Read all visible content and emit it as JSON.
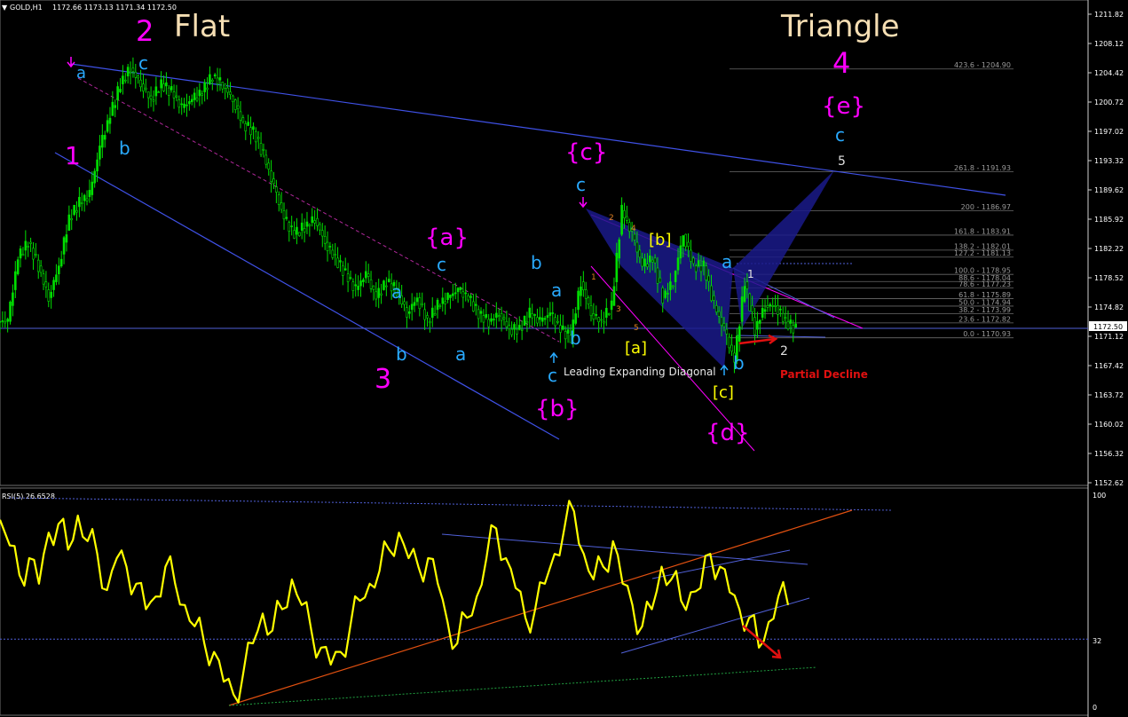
{
  "header": {
    "symbol": "GOLD,H1",
    "ohlc": "1172.66 1173.13 1171.34 1172.50",
    "rsi_label": "RSI(5) 26.6528"
  },
  "titles": {
    "flat_num": "2",
    "flat": "Flat",
    "triangle": "Triangle",
    "triangle_num": "4"
  },
  "texts": {
    "leading_diagonal": "Leading Expanding Diagonal",
    "partial_decline": "Partial Decline"
  },
  "colors": {
    "background": "#000000",
    "bull_candle": "#00e000",
    "wave_magenta": "#ff00ff",
    "wave_cyan": "#29aaff",
    "wave_yellow": "#ffff00",
    "title_beige": "#f5deb3",
    "rsi_line": "#ffff00",
    "trendline_blue": "#3f51e6",
    "annotation_red": "#e01010",
    "triangle_fill": "#1a1a8a"
  },
  "chart_data": [
    {
      "type": "candlestick",
      "title": "",
      "ylim": [
        1152.62,
        1213.0
      ],
      "y_ticks": [
        "1211.82",
        "1208.12",
        "1204.42",
        "1200.72",
        "1197.02",
        "1193.32",
        "1189.62",
        "1185.92",
        "1182.22",
        "1178.52",
        "1174.82",
        "1171.12",
        "1167.42",
        "1163.72",
        "1160.02",
        "1156.32",
        "1152.62"
      ],
      "current_price": "1172.50",
      "close_path": [
        1173,
        1181,
        1183,
        1180,
        1176,
        1180,
        1186,
        1188,
        1189,
        1195,
        1199,
        1203,
        1205,
        1203,
        1201,
        1203,
        1202,
        1200,
        1201,
        1202,
        1204,
        1203,
        1201,
        1198,
        1197,
        1194,
        1190,
        1186,
        1184,
        1185,
        1186,
        1183,
        1181,
        1179,
        1177,
        1179,
        1176,
        1178,
        1177,
        1174,
        1176,
        1173,
        1175,
        1176,
        1177,
        1176,
        1174,
        1173,
        1174,
        1172,
        1172,
        1174,
        1173,
        1174,
        1172,
        1171,
        1178,
        1174,
        1173,
        1175,
        1187,
        1184,
        1180,
        1181,
        1176,
        1178,
        1184,
        1180,
        1180,
        1175,
        1172,
        1168,
        1178,
        1172,
        1175,
        1175,
        1173,
        1172
      ],
      "fib_levels": [
        {
          "label": "423.6 - 1204.90",
          "value": 1204.9
        },
        {
          "label": "261.8 - 1191.93",
          "value": 1191.93
        },
        {
          "label": "200 - 1186.97",
          "value": 1186.97
        },
        {
          "label": "161.8 - 1183.91",
          "value": 1183.91
        },
        {
          "label": "138.2 - 1182.01",
          "value": 1182.01
        },
        {
          "label": "127.2 - 1181.13",
          "value": 1181.13
        },
        {
          "label": "100.0 - 1178.95",
          "value": 1178.95
        },
        {
          "label": "88.6 - 1178.04",
          "value": 1178.04
        },
        {
          "label": "78.6 - 1177.23",
          "value": 1177.23
        },
        {
          "label": "61.8 - 1175.89",
          "value": 1175.89
        },
        {
          "label": "50.0 - 1174.94",
          "value": 1174.94
        },
        {
          "label": "38.2 - 1173.99",
          "value": 1173.99
        },
        {
          "label": "23.6 - 1172.82",
          "value": 1172.82
        },
        {
          "label": "0.0 - 1170.93",
          "value": 1170.93
        }
      ],
      "wave_labels": [
        {
          "text": "2",
          "role": "magenta"
        },
        {
          "text": "1",
          "role": "magenta"
        },
        {
          "text": "3",
          "role": "magenta"
        },
        {
          "text": "4",
          "role": "magenta"
        },
        {
          "text": "{a}",
          "role": "magenta"
        },
        {
          "text": "{b}",
          "role": "magenta"
        },
        {
          "text": "{c}",
          "role": "magenta"
        },
        {
          "text": "{d}",
          "role": "magenta"
        },
        {
          "text": "{e}",
          "role": "magenta"
        },
        {
          "text": "a",
          "role": "cyan"
        },
        {
          "text": "c",
          "role": "cyan"
        },
        {
          "text": "b",
          "role": "cyan"
        },
        {
          "text": "a",
          "role": "cyan"
        },
        {
          "text": "b",
          "role": "cyan"
        },
        {
          "text": "c",
          "role": "cyan"
        },
        {
          "text": "a",
          "role": "cyan"
        },
        {
          "text": "b",
          "role": "cyan"
        },
        {
          "text": "a",
          "role": "cyan"
        },
        {
          "text": "b",
          "role": "cyan"
        },
        {
          "text": "c",
          "role": "cyan"
        },
        {
          "text": "c",
          "role": "cyan"
        },
        {
          "text": "a",
          "role": "cyan"
        },
        {
          "text": "b",
          "role": "cyan"
        },
        {
          "text": "c",
          "role": "cyan"
        },
        {
          "text": "[a]",
          "role": "yellow"
        },
        {
          "text": "[b]",
          "role": "yellow"
        },
        {
          "text": "[c]",
          "role": "yellow"
        },
        {
          "text": "1",
          "role": "white"
        },
        {
          "text": "2",
          "role": "white"
        },
        {
          "text": "5",
          "role": "white"
        },
        {
          "text": "1",
          "role": "orange"
        },
        {
          "text": "2",
          "role": "orange"
        },
        {
          "text": "3",
          "role": "orange"
        },
        {
          "text": "4",
          "role": "orange"
        },
        {
          "text": "5",
          "role": "orange"
        }
      ]
    },
    {
      "type": "line",
      "title": "RSI(5) 26.6528",
      "ylim": [
        0,
        100
      ],
      "y_ticks": [
        "100",
        "32",
        "0"
      ],
      "level_line": 32,
      "series": [
        {
          "values": [
            88,
            76,
            62,
            70,
            58,
            82,
            86,
            74,
            90,
            78,
            72,
            55,
            70,
            66,
            58,
            46,
            52,
            66,
            58,
            48,
            38,
            30,
            26,
            12,
            6,
            16,
            30,
            44,
            36,
            46,
            60,
            48,
            36,
            28,
            20,
            26,
            38,
            50,
            58,
            64,
            74,
            82,
            70,
            66,
            70,
            58,
            40,
            30,
            42,
            52,
            70,
            84,
            70,
            56,
            42,
            46,
            58,
            72,
            84,
            92,
            72,
            60,
            66,
            78,
            58,
            48,
            38,
            46,
            66,
            60,
            50,
            54,
            56,
            72,
            66,
            54,
            46,
            42,
            28,
            40,
            52,
            48
          ]
        }
      ]
    }
  ]
}
